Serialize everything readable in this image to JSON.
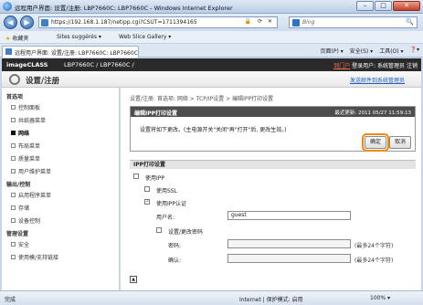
{
  "window": {
    "title": "远程用户界面: 设置/注册: LBP7660C: LBP7660C - Windows Internet Explorer",
    "minimize": "–",
    "maximize": "□",
    "close": "✕"
  },
  "address": {
    "back": "◀",
    "forward": "▶",
    "url": "https://192.168.1.187/netipp.cgi?CSUT=1711394165",
    "lock": "🔒",
    "refresh": "⟳",
    "stop": "✕"
  },
  "search": {
    "placeholder": "Bing",
    "go": "🔍"
  },
  "favorites": {
    "label": "收藏夹",
    "items": [
      "Sites suggérés ▾",
      "Web Slice Gallery ▾"
    ]
  },
  "tab": {
    "label": "远程用户界面: 设置/注册: LBP7660C: LBP7660C"
  },
  "commands": [
    "页面(P) ▾",
    "安全(S) ▾",
    "工具(O) ▾",
    "❓▾"
  ],
  "page_header": {
    "brand": "imageCLASS",
    "model": "LBP7660C / LBP7660C /",
    "link_portal": "到门户",
    "login_user": "登录用户: 系统管理员",
    "logout": "注销"
  },
  "sub_header": {
    "title": "设置/注册",
    "mail_link": "发送邮件到系统管理员"
  },
  "sidebar": {
    "groups": [
      {
        "title": "首选项",
        "items": [
          "控制面板",
          "共纸器菜单",
          "网络",
          "布局菜单",
          "质量菜单",
          "用户维护菜单"
        ]
      },
      {
        "title": "输出/控制",
        "items": [
          "启用程序菜单",
          "存储",
          "设备控制"
        ]
      },
      {
        "title": "管理设置",
        "items": [
          "安全",
          "使用模/支持链接"
        ]
      }
    ]
  },
  "main": {
    "breadcrumb": "设置/注册: 首选项: 网络 > TCP/IP设置 > 编辑IPP打印设置",
    "panel_title": "编辑IPP打印设置",
    "last_update": "最近更新: 2011 05/27 11:59:13",
    "message": "设置将如下更改。(主电源开关\"关闭\"再\"打开\"后, 更改生效。)",
    "ok_label": "确定",
    "cancel_label": "取消",
    "section_title": "IPP打印设置",
    "use_ipp_label": "使用IPP",
    "use_ssl_label": "使用SSL",
    "use_auth_label": "使用IPP认证",
    "username_label": "用户名:",
    "username_value": "guest",
    "set_password_label": "设置/更改密码",
    "password_label": "密码:",
    "confirm_label": "确认:",
    "max_note": "(最多24个字符)",
    "max_note2": "(最多24个字符)",
    "top_icon": "▲"
  },
  "status": {
    "left": "完成",
    "zone": "Internet | 保护模式: 启用",
    "zoom": "100% ▾"
  }
}
